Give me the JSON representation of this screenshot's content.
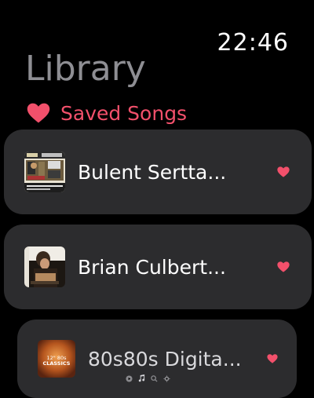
{
  "status": {
    "time": "22:46"
  },
  "header": {
    "title": "Library"
  },
  "saved": {
    "label": "Saved Songs",
    "accent_color": "#f2506b",
    "icon": "heart-icon"
  },
  "songs": [
    {
      "title": "Bulent Sertta...",
      "favorite": true,
      "artwork": "album-artwork-bulent"
    },
    {
      "title": "Brian Culbert...",
      "favorite": true,
      "artwork": "album-artwork-brian"
    },
    {
      "title": "80s80s Digita...",
      "favorite": true,
      "artwork": "album-artwork-80s80s"
    }
  ],
  "artwork_text": {
    "eighties_top": "12\" 80s",
    "eighties_bottom": "CLASSICS"
  },
  "page_indicator": {
    "icons": [
      "play-icon",
      "music-icon",
      "search-icon",
      "settings-icon"
    ]
  }
}
